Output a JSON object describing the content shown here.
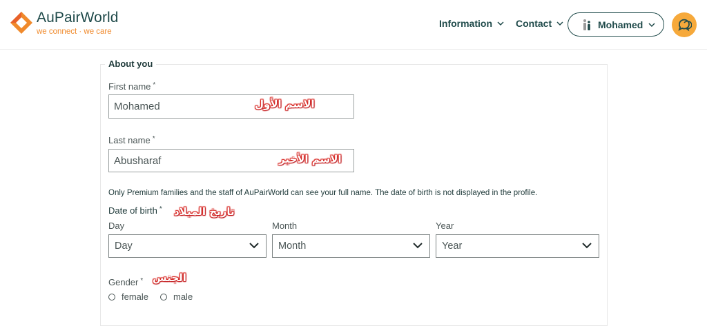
{
  "header": {
    "logo_name": "AuPairWorld",
    "logo_tagline": "we connect · we care",
    "nav": [
      {
        "label": "Information"
      },
      {
        "label": "Contact"
      }
    ],
    "user_label": "Mohamed"
  },
  "form": {
    "section_title": "About you",
    "required_mark": "*",
    "first_name": {
      "label": "First name",
      "value": "Mohamed",
      "annotation": "الاسم الأول"
    },
    "last_name": {
      "label": "Last name",
      "value": "Abusharaf",
      "annotation": "الاسم الأخير"
    },
    "privacy_note": "Only Premium families and the staff of AuPairWorld can see your full name. The date of birth is not displayed in the profile.",
    "dob": {
      "label": "Date of birth",
      "annotation": "تاريخ الميلاد",
      "day": {
        "label": "Day",
        "selected": "Day"
      },
      "month": {
        "label": "Month",
        "selected": "Month"
      },
      "year": {
        "label": "Year",
        "selected": "Year"
      }
    },
    "gender": {
      "label": "Gender",
      "annotation": "الجنس",
      "options": [
        {
          "label": "female"
        },
        {
          "label": "male"
        }
      ]
    }
  },
  "colors": {
    "brand_dark": "#1f4a4a",
    "brand_orange": "#f08a2c",
    "chat_button": "#f6a93b",
    "annotation_red": "#d8241f"
  }
}
